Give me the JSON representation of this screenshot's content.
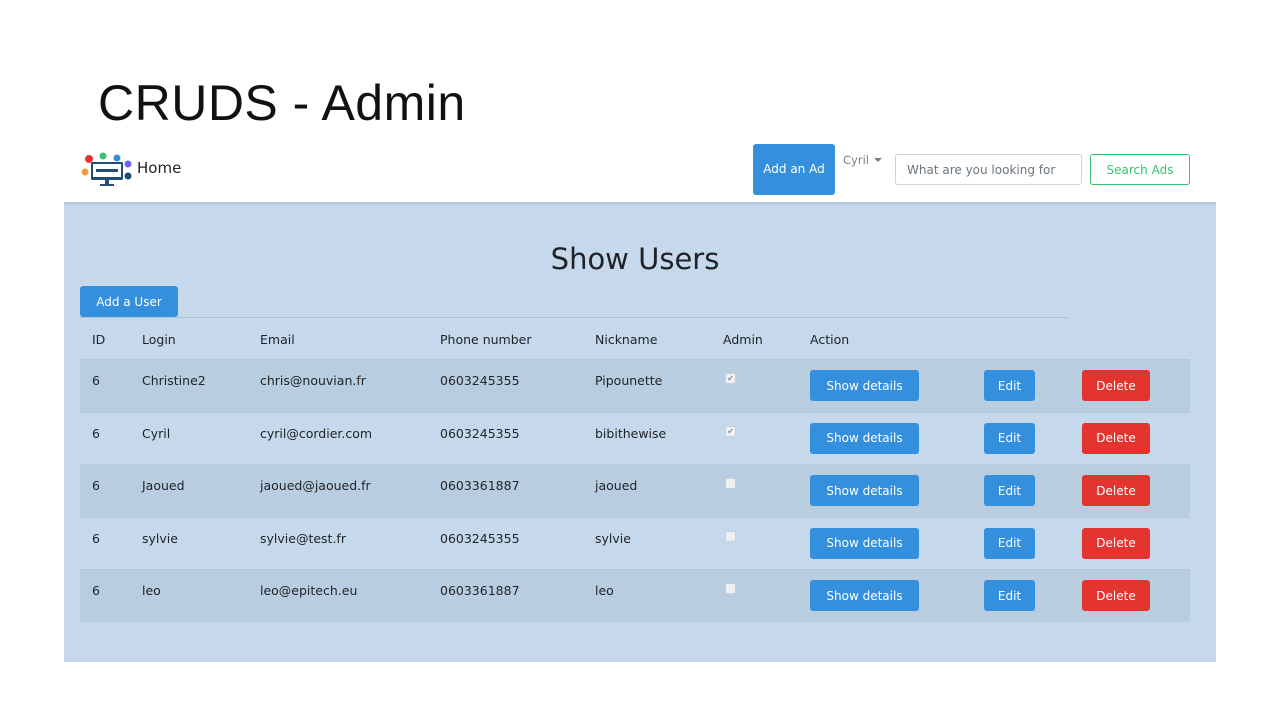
{
  "slide": {
    "title": "CRUDS - Admin"
  },
  "navbar": {
    "brand_label": "Home",
    "add_ad_label": "Add an Ad",
    "user_menu_label": "Cyril",
    "search_placeholder": "What are you looking for",
    "search_button_label": "Search Ads"
  },
  "colors": {
    "primary": "#3490dc",
    "danger": "#e3342f",
    "success": "#38c172",
    "panel_bg": "#c5d8ec"
  },
  "main": {
    "heading": "Show Users",
    "add_user_label": "Add a User",
    "columns": [
      "ID",
      "Login",
      "Email",
      "Phone number",
      "Nickname",
      "Admin",
      "Action"
    ],
    "rows": [
      {
        "id": "6",
        "login": "Christine2",
        "email": "chris@nouvian.fr",
        "phone": "0603245355",
        "nickname": "Pipounette",
        "admin": true
      },
      {
        "id": "6",
        "login": "Cyril",
        "email": "cyril@cordier.com",
        "phone": "0603245355",
        "nickname": "bibithewise",
        "admin": true
      },
      {
        "id": "6",
        "login": "Jaoued",
        "email": "jaoued@jaoued.fr",
        "phone": "0603361887",
        "nickname": "jaoued",
        "admin": false
      },
      {
        "id": "6",
        "login": "sylvie",
        "email": "sylvie@test.fr",
        "phone": "0603245355",
        "nickname": "sylvie",
        "admin": false
      },
      {
        "id": "6",
        "login": "leo",
        "email": "leo@epitech.eu",
        "phone": "0603361887",
        "nickname": "leo",
        "admin": false
      }
    ],
    "action_labels": {
      "details": "Show details",
      "edit": "Edit",
      "delete": "Delete"
    }
  }
}
